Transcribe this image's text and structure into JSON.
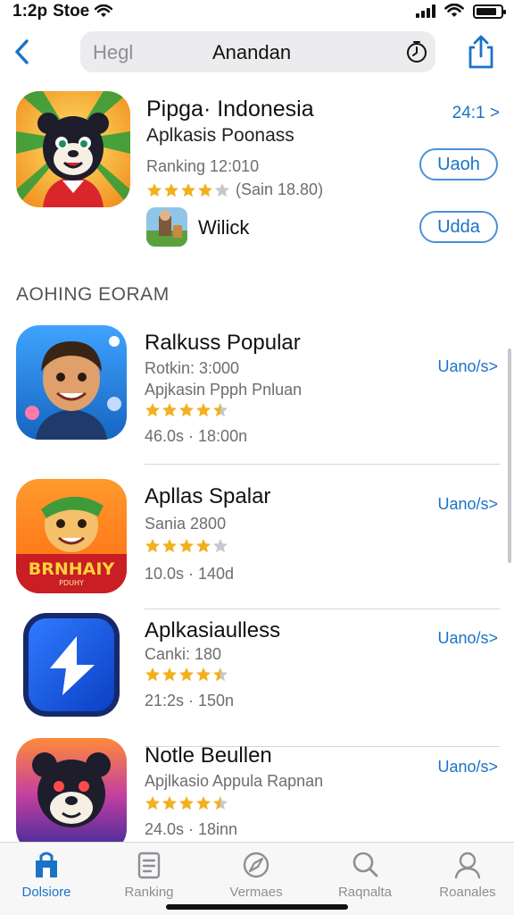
{
  "status_bar": {
    "time": "1:2p",
    "carrier": "Stoe"
  },
  "nav": {
    "search_placeholder": "Hegl",
    "search_title": "Anandan"
  },
  "featured": {
    "title": "Pipga· Indonesia",
    "subtitle": "Aplkasis Poonass",
    "ranking": "Ranking 12:010",
    "rating": 4,
    "rating_text": "(Sain 18.80)",
    "price": "24:1 >",
    "button_primary": "Uaoh",
    "button_secondary": "Udda",
    "secondary_app_label": "Wilick"
  },
  "section_title": "AOHING EORAM",
  "apps": [
    {
      "title": "Ralkuss Popular",
      "line1": "Rotkin: 3:000",
      "line2": "Apjkasin Ppph Pnluan",
      "rating": 4.5,
      "meta": "46.0s · 18:00n",
      "action": "Uano/s>"
    },
    {
      "title": "Apllas Spalar",
      "line1": "Sania 2800",
      "line2": "",
      "rating": 4,
      "meta": "10.0s · 140d",
      "action": "Uano/s>",
      "icon_text": "BRNHAIY",
      "icon_subtext": "PDUHY"
    },
    {
      "title": "Aplkasiaulless",
      "line1": "Canki: 180",
      "line2": "",
      "rating": 4.5,
      "meta": "21:2s · 150n",
      "action": "Uano/s>"
    },
    {
      "title": "Notle Beullen",
      "line1": "Apjlkasio Appula Rapnan",
      "line2": "",
      "rating": 4.5,
      "meta": "24.0s · 18inn",
      "action": "Uano/s>"
    }
  ],
  "tabs": [
    {
      "label": "Dolsiore",
      "icon": "store-icon",
      "active": true
    },
    {
      "label": "Ranking",
      "icon": "list-icon",
      "active": false
    },
    {
      "label": "Vermaes",
      "icon": "compass-icon",
      "active": false
    },
    {
      "label": "Raqnalta",
      "icon": "search-icon",
      "active": false
    },
    {
      "label": "Roanales",
      "icon": "person-icon",
      "active": false
    }
  ],
  "colors": {
    "accent": "#1a73c8",
    "star": "#f2b01e",
    "star_empty": "#c7c7cc"
  }
}
